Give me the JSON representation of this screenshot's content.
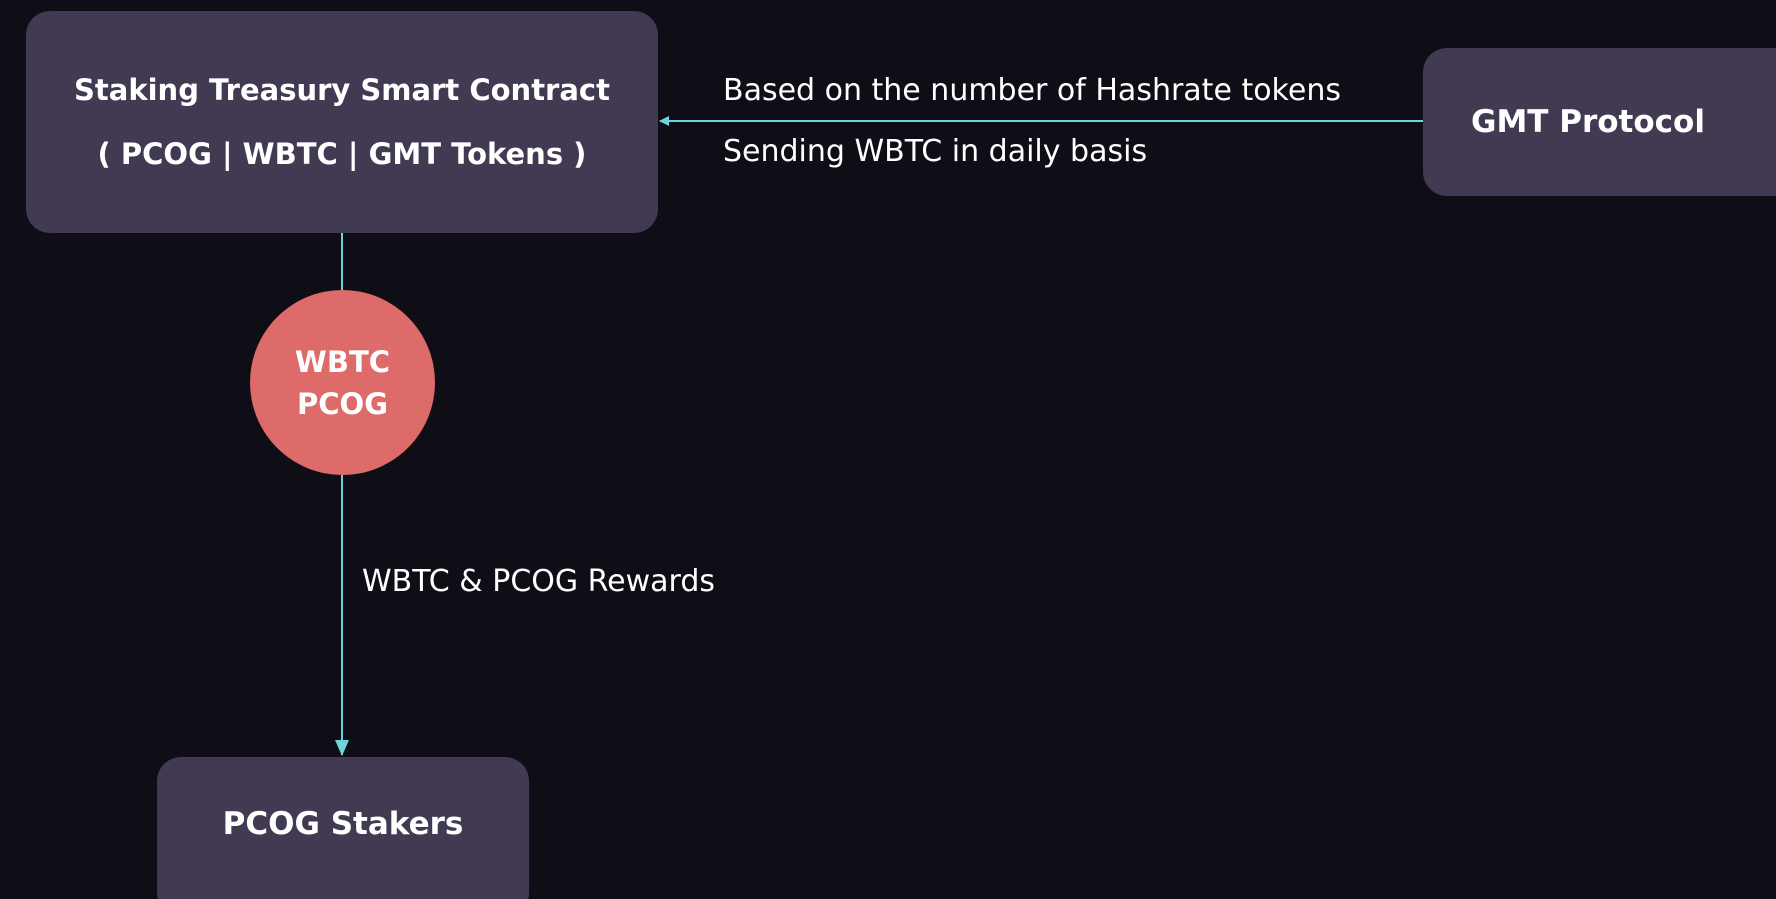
{
  "nodes": {
    "treasury": {
      "line1": "Staking Treasury Smart Contract",
      "line2": "( PCOG | WBTC | GMT Tokens )"
    },
    "gmt_protocol": {
      "label": "GMT Protocol"
    },
    "token_circle": {
      "line1": "WBTC",
      "line2": "PCOG"
    },
    "stakers": {
      "label": "PCOG Stakers"
    }
  },
  "edges": {
    "gmt_to_treasury": {
      "label_top": "Based on the number of Hashrate tokens",
      "label_bottom": "Sending WBTC in daily basis"
    },
    "treasury_to_stakers": {
      "label": "WBTC & PCOG Rewards"
    }
  },
  "colors": {
    "background": "#0f0e17",
    "node_fill": "#413a52",
    "circle_fill": "#dc6b69",
    "connector": "#6fd3dd",
    "text": "#ffffff"
  }
}
